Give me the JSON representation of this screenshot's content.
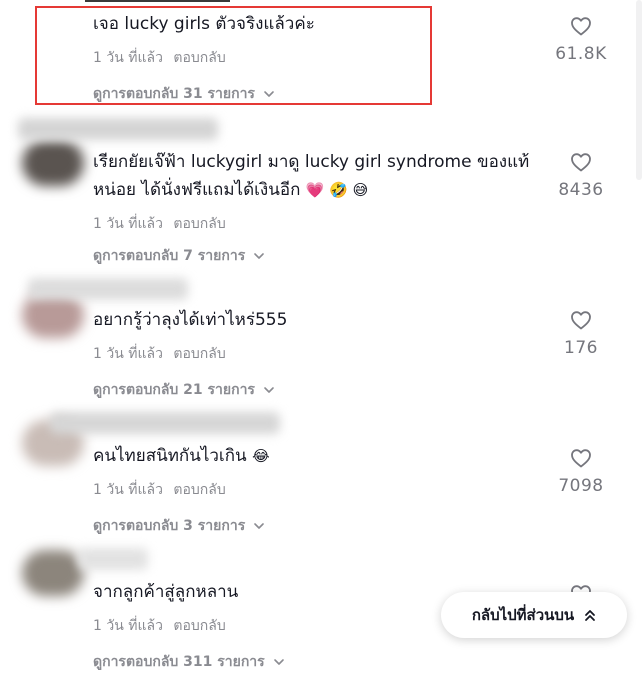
{
  "comments": [
    {
      "text": "เจอ lucky girls ตัวจริงแล้วค่ะ",
      "time": "1 วัน ที่แล้ว",
      "reply": "ตอบกลับ",
      "view_replies": "ดูการตอบกลับ 31 รายการ",
      "likes": "61.8K"
    },
    {
      "text": "เรียกยัยเจ๊ฟ้า luckygirl มาดู lucky girl syndrome ของแท้หน่อย ได้นั่งฟรีแถมได้เงินอีก",
      "emojis": "💗 🤣 😅",
      "time": "1 วัน ที่แล้ว",
      "reply": "ตอบกลับ",
      "view_replies": "ดูการตอบกลับ 7 รายการ",
      "likes": "8436"
    },
    {
      "text": "อยากรู้ว่าลุงได้เท่าไหร่555",
      "time": "1 วัน ที่แล้ว",
      "reply": "ตอบกลับ",
      "view_replies": "ดูการตอบกลับ 21 รายการ",
      "likes": "176"
    },
    {
      "text": "คนไทยสนิทกันไวเกิน",
      "emojis": "😂",
      "time": "1 วัน ที่แล้ว",
      "reply": "ตอบกลับ",
      "view_replies": "ดูการตอบกลับ 3 รายการ",
      "likes": "7098"
    },
    {
      "text": "จากลูกค้าสู่ลูกหลาน",
      "time": "1 วัน ที่แล้ว",
      "reply": "ตอบกลับ",
      "view_replies": "ดูการตอบกลับ 311 รายการ",
      "likes": ""
    }
  ],
  "back_to_top": "กลับไปที่ส่วนบน",
  "colors": {
    "highlight": "#e53935",
    "text": "#161823",
    "muted": "#8a8b91"
  }
}
